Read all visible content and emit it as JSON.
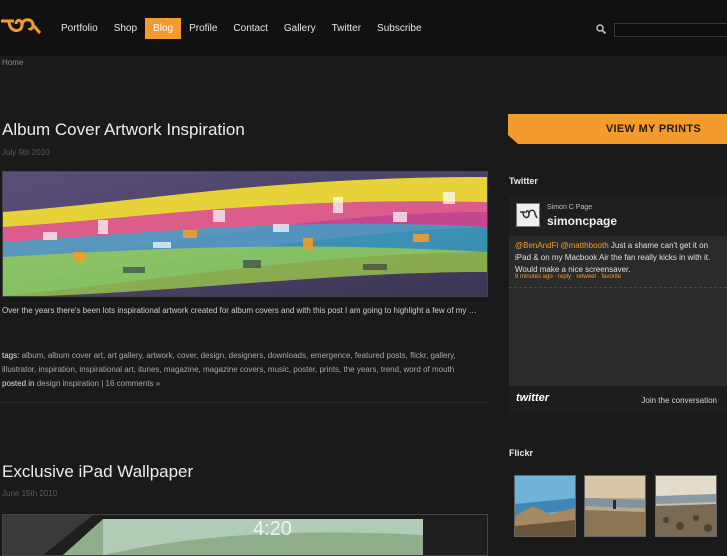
{
  "nav": {
    "items": [
      {
        "label": "Portfolio",
        "active": false
      },
      {
        "label": "Shop",
        "active": false
      },
      {
        "label": "Blog",
        "active": true
      },
      {
        "label": "Profile",
        "active": false
      },
      {
        "label": "Contact",
        "active": false
      },
      {
        "label": "Gallery",
        "active": false
      },
      {
        "label": "Twitter",
        "active": false
      },
      {
        "label": "Subscribe",
        "active": false
      }
    ]
  },
  "search": {
    "value": "",
    "placeholder": ""
  },
  "breadcrumb": "Home",
  "posts": [
    {
      "title": "Album Cover Artwork Inspiration",
      "date": "July 9th 2010",
      "excerpt": "Over the years there's been lots inspirational artwork created for album covers and with this post I am going to highlight a few of my …",
      "tags_label": "tags:",
      "tags": "album, album cover art, art gallery, artwork, cover, design, designers, downloads, emergence, featured posts, flickr, gallery, illustrator, inspiration, inspirational art, itunes, magazine, magazine covers, music, poster, prints, the years, trend, word of mouth",
      "posted_label": "posted in",
      "category": "design inspiration",
      "separator": "|",
      "comments": "16 comments »"
    },
    {
      "title": "Exclusive iPad Wallpaper",
      "date": "June 15th 2010"
    }
  ],
  "sidebar": {
    "prints_label": "VIEW MY PRINTS",
    "twitter_heading": "Twitter",
    "tweet": {
      "name": "Simon C Page",
      "handle": "simoncpage",
      "mention1": "@BenAndFi",
      "mention2": "@matthbooth",
      "text": " Just a shame can't get it on iPad & on my Macbook Air the fan really kicks in with it. Would make a nice screensaver.",
      "time": "9 minutes ago",
      "reply": "reply",
      "retweet": "retweet",
      "favorite": "favorite",
      "meta_sep": "·",
      "logo": "twitter",
      "join": "Join the conversation"
    },
    "flickr_heading": "Flickr"
  },
  "colors": {
    "accent": "#f39b2c",
    "background": "#1a1a1a",
    "header": "#111111"
  }
}
